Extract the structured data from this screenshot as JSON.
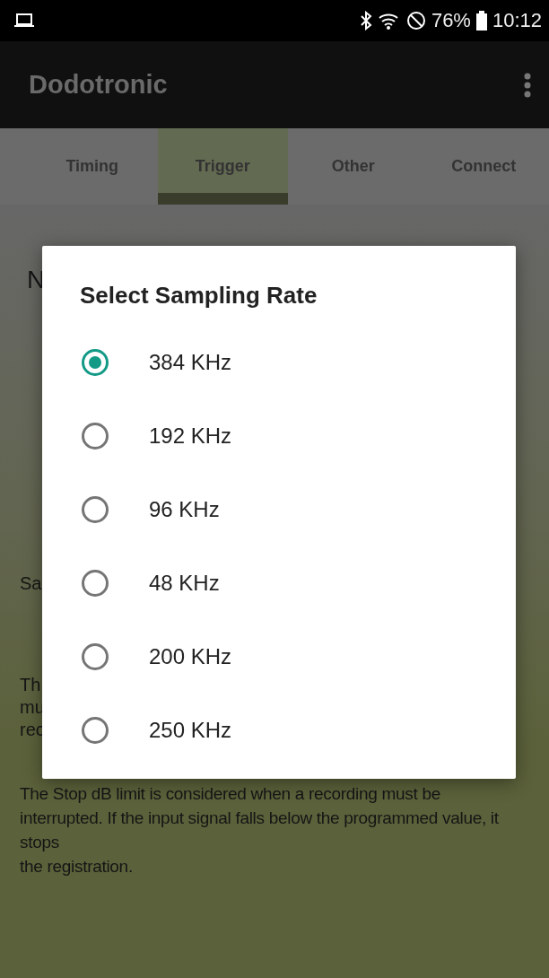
{
  "status_bar": {
    "battery": "76%",
    "time": "10:12"
  },
  "app_bar": {
    "title": "Dodotronic"
  },
  "tabs": [
    {
      "label": "Timing",
      "selected": false
    },
    {
      "label": "Trigger",
      "selected": true
    },
    {
      "label": "Other",
      "selected": false
    },
    {
      "label": "Connect",
      "selected": false
    }
  ],
  "background": {
    "heading_fragment": "N",
    "label_fragment": "Sa",
    "paragraph_fragments": [
      "Th",
      "mu",
      "rec"
    ],
    "paragraph": "The Stop dB limit is considered when a recording must be interrupted. If the input signal falls below the programmed value, it stops\nthe registration."
  },
  "dialog": {
    "title": "Select Sampling Rate",
    "options": [
      {
        "label": "384 KHz",
        "selected": true
      },
      {
        "label": "192 KHz",
        "selected": false
      },
      {
        "label": "96 KHz",
        "selected": false
      },
      {
        "label": "48 KHz",
        "selected": false
      },
      {
        "label": "200 KHz",
        "selected": false
      },
      {
        "label": "250 KHz",
        "selected": false
      }
    ]
  }
}
